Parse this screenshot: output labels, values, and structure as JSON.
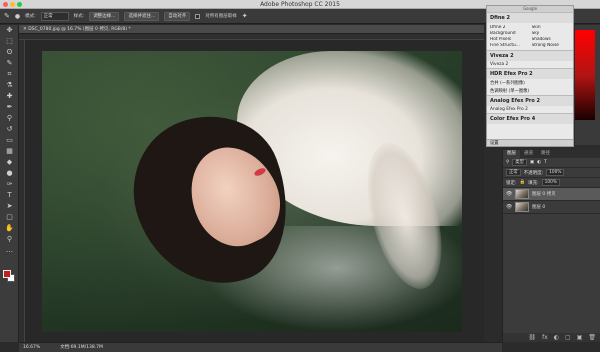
{
  "window": {
    "title": "Adobe Photoshop CC 2015"
  },
  "options_bar": {
    "mode_label": "模式:",
    "mode_value": "正常",
    "style_label": "样式:",
    "btn_refine": "调整边缘...",
    "btn_select_mask": "选择并遮住...",
    "btn_align": "自动对齐",
    "sample_all_label": "对所有图层取样",
    "btn_enhance": "增强"
  },
  "document": {
    "tab_title": "DSC_0780.jpg @ 16.7% (图层 0 拷贝, RGB/8) *"
  },
  "tools": [
    {
      "name": "move-tool-icon",
      "glyph": "✥"
    },
    {
      "name": "marquee-tool-icon",
      "glyph": "⬚"
    },
    {
      "name": "lasso-tool-icon",
      "glyph": "ʘ"
    },
    {
      "name": "quick-select-tool-icon",
      "glyph": "✎"
    },
    {
      "name": "crop-tool-icon",
      "glyph": "⌗"
    },
    {
      "name": "eyedropper-tool-icon",
      "glyph": "⚗"
    },
    {
      "name": "healing-tool-icon",
      "glyph": "✚"
    },
    {
      "name": "brush-tool-icon",
      "glyph": "✒"
    },
    {
      "name": "stamp-tool-icon",
      "glyph": "⚲"
    },
    {
      "name": "history-brush-tool-icon",
      "glyph": "↺"
    },
    {
      "name": "eraser-tool-icon",
      "glyph": "▭"
    },
    {
      "name": "gradient-tool-icon",
      "glyph": "▦"
    },
    {
      "name": "blur-tool-icon",
      "glyph": "◆"
    },
    {
      "name": "dodge-tool-icon",
      "glyph": "●"
    },
    {
      "name": "pen-tool-icon",
      "glyph": "✑"
    },
    {
      "name": "type-tool-icon",
      "glyph": "T"
    },
    {
      "name": "path-select-tool-icon",
      "glyph": "➤"
    },
    {
      "name": "shape-tool-icon",
      "glyph": "▢"
    },
    {
      "name": "hand-tool-icon",
      "glyph": "✋"
    },
    {
      "name": "zoom-tool-icon",
      "glyph": "⚲"
    },
    {
      "name": "more-tools-icon",
      "glyph": "…"
    }
  ],
  "google_panel": {
    "header": "Google",
    "dfine": {
      "title": "Dfine 2",
      "items": [
        "Dfine 2",
        "Skin",
        "Background",
        "Sky",
        "Hot Pixels",
        "Shadows",
        "Fine Structu...",
        "Strong Noise"
      ]
    },
    "viveza": {
      "title": "Viveza 2",
      "items": [
        "Viveza 2"
      ]
    },
    "hdr": {
      "title": "HDR Efex Pro 2",
      "items": [
        "合并 (一系列图像)",
        "色调映射 (单一图像)"
      ]
    },
    "analog": {
      "title": "Analog Efex Pro 2",
      "items": [
        "Analog Efex Pro 2"
      ]
    },
    "color": {
      "title": "Color Efex Pro 4"
    },
    "footer": "设置"
  },
  "layers_panel": {
    "tabs": [
      "图层",
      "通道",
      "路径"
    ],
    "kind_label": "类型",
    "blend_mode": "正常",
    "opacity_label": "不透明度:",
    "opacity_value": "100%",
    "lock_label": "锁定:",
    "fill_label": "填充:",
    "fill_value": "100%",
    "layers": [
      {
        "name": "图层 0 拷贝",
        "selected": true
      },
      {
        "name": "图层 0",
        "selected": false
      }
    ],
    "bottom_icons": [
      "⛓",
      "fx",
      "◐",
      "▢",
      "▣",
      "🗑"
    ]
  },
  "status_bar": {
    "zoom": "16.67%",
    "doc_size": "文档:69.1M/138.7M"
  },
  "colors": {
    "foreground": "#c11f1f",
    "background": "#ffffff"
  }
}
